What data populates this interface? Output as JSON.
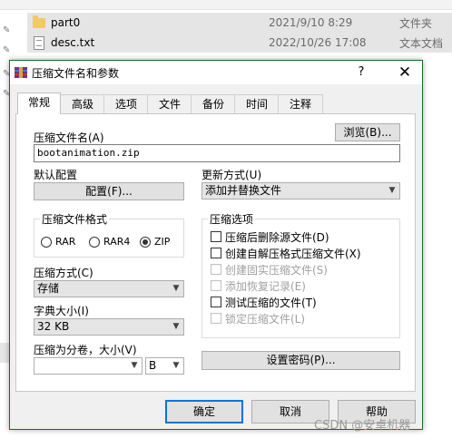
{
  "explorer": {
    "rows": [
      {
        "name": "part0",
        "date": "2021/9/10 8:29",
        "type": "文件夹",
        "icon": "folder-icon"
      },
      {
        "name": "desc.txt",
        "date": "2022/10/26 17:08",
        "type": "文本文档",
        "icon": "text-file-icon"
      }
    ]
  },
  "dialog": {
    "title": "压缩文件名和参数",
    "help_label": "?",
    "close_label": "✕",
    "tabs": [
      "常规",
      "高级",
      "选项",
      "文件",
      "备份",
      "时间",
      "注释"
    ],
    "active_tab": "常规",
    "archive_name_label": "压缩文件名(A)",
    "browse_label": "浏览(B)...",
    "archive_name_value": "bootanimation.zip",
    "default_profile_label": "默认配置",
    "profile_button": "配置(F)...",
    "update_mode_label": "更新方式(U)",
    "update_mode_value": "添加并替换文件",
    "format_group": "压缩文件格式",
    "formats": [
      "RAR",
      "RAR4",
      "ZIP"
    ],
    "selected_format": "ZIP",
    "method_label": "压缩方式(C)",
    "method_value": "存储",
    "dict_label": "字典大小(I)",
    "dict_value": "32 KB",
    "split_label": "压缩为分卷，大小(V)",
    "split_value": "",
    "split_unit": "B",
    "options_group": "压缩选项",
    "options": [
      {
        "label": "压缩后删除源文件(D)",
        "checked": false,
        "enabled": true
      },
      {
        "label": "创建自解压格式压缩文件(X)",
        "checked": false,
        "enabled": true
      },
      {
        "label": "创建固实压缩文件(S)",
        "checked": false,
        "enabled": false
      },
      {
        "label": "添加恢复记录(E)",
        "checked": false,
        "enabled": false
      },
      {
        "label": "测试压缩的文件(T)",
        "checked": false,
        "enabled": true
      },
      {
        "label": "锁定压缩文件(L)",
        "checked": false,
        "enabled": false
      }
    ],
    "password_button": "设置密码(P)...",
    "ok_button": "确定",
    "cancel_button": "取消",
    "help_button": "帮助"
  },
  "watermark": "CSDN @安卓机器",
  "colors": {
    "dialog_border": "#1a6b2a",
    "accent": "#0078d7"
  }
}
